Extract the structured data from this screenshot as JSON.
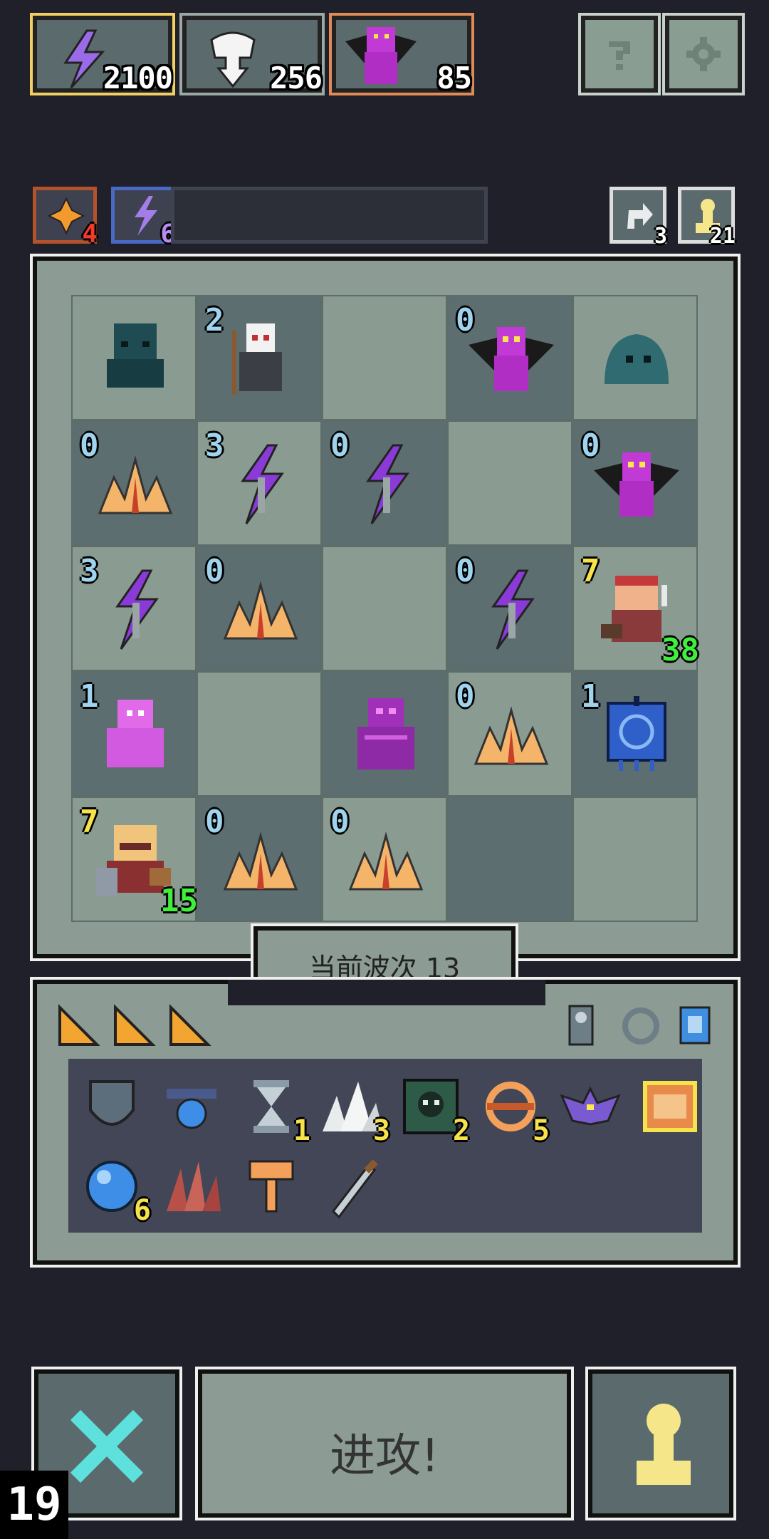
{
  "resources": {
    "energy": "2100",
    "souls": "256",
    "boss": "85"
  },
  "boosts": {
    "fire": "4",
    "lightning": "6"
  },
  "counters": {
    "rerolls": "3",
    "units": "21"
  },
  "board": {
    "rows": [
      [
        {
          "type": "cthulhu",
          "level": ""
        },
        {
          "type": "skeleton-shaman",
          "level": "2"
        },
        {
          "type": "empty",
          "level": ""
        },
        {
          "type": "dragon",
          "level": "0"
        },
        {
          "type": "slime",
          "level": ""
        }
      ],
      [
        {
          "type": "fire-crystal",
          "level": "0"
        },
        {
          "type": "lightning",
          "level": "3"
        },
        {
          "type": "lightning",
          "level": "0"
        },
        {
          "type": "empty",
          "level": ""
        },
        {
          "type": "dragon",
          "level": "0"
        }
      ],
      [
        {
          "type": "lightning",
          "level": "3"
        },
        {
          "type": "fire-crystal",
          "level": "0"
        },
        {
          "type": "empty",
          "level": ""
        },
        {
          "type": "lightning",
          "level": "0"
        },
        {
          "type": "hero-warrior",
          "level": "7",
          "hp": "38"
        }
      ],
      [
        {
          "type": "pink-demon",
          "level": "1"
        },
        {
          "type": "empty",
          "level": ""
        },
        {
          "type": "purple-golem",
          "level": ""
        },
        {
          "type": "fire-crystal",
          "level": "0"
        },
        {
          "type": "blue-banner",
          "level": "1"
        }
      ],
      [
        {
          "type": "hero-knight",
          "level": "7",
          "hp": "15"
        },
        {
          "type": "fire-crystal",
          "level": "0"
        },
        {
          "type": "fire-crystal",
          "level": "0"
        },
        {
          "type": "empty",
          "level": ""
        },
        {
          "type": "empty",
          "level": ""
        }
      ]
    ]
  },
  "wave_label": "当前波次 13",
  "inventory": {
    "top_row": [
      "ticket-icon",
      "ticket-icon",
      "ticket-icon"
    ],
    "items": [
      {
        "icon": "shield-icon",
        "count": ""
      },
      {
        "icon": "amulet-icon",
        "count": ""
      },
      {
        "icon": "hourglass-icon",
        "count": "1"
      },
      {
        "icon": "spikes-icon",
        "count": "3"
      },
      {
        "icon": "skull-box-icon",
        "count": "2"
      },
      {
        "icon": "ring-icon",
        "count": "5"
      },
      {
        "icon": "bat-icon",
        "count": ""
      },
      {
        "icon": "scroll-icon",
        "count": ""
      },
      {
        "icon": "orb-icon",
        "count": "6"
      },
      {
        "icon": "claw-icon",
        "count": ""
      },
      {
        "icon": "key-icon",
        "count": ""
      },
      {
        "icon": "sword-icon",
        "count": ""
      }
    ]
  },
  "attack_label": "进攻!",
  "wave_counter": "19",
  "colors": {
    "bg": "#1f2029",
    "panel": "#8c9c94",
    "cell_light": "#8a9b92",
    "cell_dark": "#5d6e70",
    "level": "#9fd3ee",
    "hp": "#3ef03a",
    "count": "#f6e24a"
  }
}
